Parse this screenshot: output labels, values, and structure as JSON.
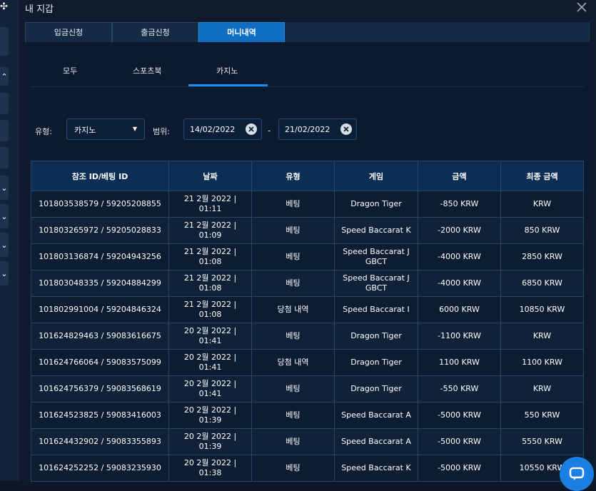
{
  "modal": {
    "title": "내 지갑"
  },
  "tabs": [
    {
      "label": "입금신청"
    },
    {
      "label": "출금신청"
    },
    {
      "label": "머니내역"
    }
  ],
  "subtabs": [
    {
      "label": "모두"
    },
    {
      "label": "스포츠북"
    },
    {
      "label": "카지노"
    }
  ],
  "filters": {
    "type_label": "유형:",
    "type_value": "카지노",
    "range_label": "범위:",
    "date_from": "14/02/2022",
    "date_to": "21/02/2022",
    "separator": "-"
  },
  "table": {
    "headers": [
      "참조 ID/베팅 ID",
      "날짜",
      "유형",
      "게임",
      "금액",
      "최종 금액"
    ],
    "rows": [
      [
        "101803538579 / 59205208855",
        "21 2월 2022 |\n01:11",
        "베팅",
        "Dragon Tiger",
        "-850 KRW",
        "KRW"
      ],
      [
        "101803265972 / 59205028833",
        "21 2월 2022 |\n01:09",
        "베팅",
        "Speed Baccarat K",
        "-2000 KRW",
        "850 KRW"
      ],
      [
        "101803136874 / 59204943256",
        "21 2월 2022 |\n01:08",
        "베팅",
        "Speed Baccarat J\nGBCT",
        "-4000 KRW",
        "2850 KRW"
      ],
      [
        "101803048335 / 59204884299",
        "21 2월 2022 |\n01:08",
        "베팅",
        "Speed Baccarat J\nGBCT",
        "-4000 KRW",
        "6850 KRW"
      ],
      [
        "101802991004 / 59204846324",
        "21 2월 2022 |\n01:08",
        "당첨 내역",
        "Speed Baccarat I",
        "6000 KRW",
        "10850 KRW"
      ],
      [
        "101624829463 / 59083616675",
        "20 2월 2022 |\n01:41",
        "베팅",
        "Dragon Tiger",
        "-1100 KRW",
        "KRW"
      ],
      [
        "101624766064 / 59083575099",
        "20 2월 2022 |\n01:41",
        "당첨 내역",
        "Dragon Tiger",
        "1100 KRW",
        "1100 KRW"
      ],
      [
        "101624756379 / 59083568619",
        "20 2월 2022 |\n01:41",
        "베팅",
        "Dragon Tiger",
        "-550 KRW",
        "KRW"
      ],
      [
        "101624523825 / 59083416003",
        "20 2월 2022 |\n01:39",
        "베팅",
        "Speed Baccarat A",
        "-5000 KRW",
        "550 KRW"
      ],
      [
        "101624432902 / 59083355893",
        "20 2월 2022 |\n01:39",
        "베팅",
        "Speed Baccarat A",
        "-5000 KRW",
        "5550 KRW"
      ],
      [
        "101624252252 / 59083235930",
        "20 2월 2022 |\n01:38",
        "베팅",
        "Speed Baccarat K",
        "-5000 KRW",
        "10550 KRW"
      ]
    ]
  },
  "colors": {
    "accent": "#1a8cf0",
    "tab_active": "#0f6ec2",
    "header_bg": "#0c2e55",
    "background": "#0c1a2d"
  },
  "icons": {
    "close": "close-icon",
    "clear": "clear-icon",
    "caret": "caret-down-icon",
    "chat": "chat-icon"
  }
}
